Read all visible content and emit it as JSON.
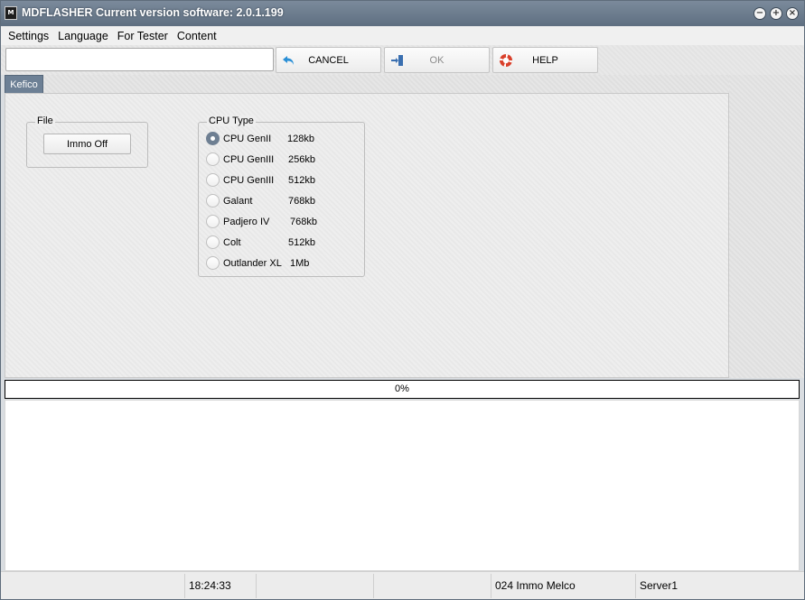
{
  "window": {
    "app_icon": "M",
    "title": "MDFLASHER  Current version software: 2.0.1.199",
    "controls": {
      "minimize": "−",
      "maximize": "+",
      "close": "×"
    }
  },
  "menu": {
    "items": [
      {
        "label": "Settings"
      },
      {
        "label": "Language"
      },
      {
        "label": "For Tester"
      },
      {
        "label": "Content"
      }
    ]
  },
  "toolbar": {
    "input_value": "",
    "cancel_label": "CANCEL",
    "ok_label": "OK",
    "help_label": "HELP",
    "colors": {
      "cancel_icon": "#2a8fd6",
      "ok_icon": "#3a6fb0",
      "help_icon": "#d9402b"
    }
  },
  "tabs": [
    {
      "label": "Kefico",
      "active": true
    }
  ],
  "file_group": {
    "title": "File",
    "immo_button": "Immo Off"
  },
  "cpu_group": {
    "title": "CPU Type",
    "options": [
      {
        "name": "CPU GenII",
        "size": "128kb",
        "checked": true
      },
      {
        "name": "CPU GenIII",
        "size": "256kb",
        "checked": false
      },
      {
        "name": "CPU GenIII",
        "size": "512kb",
        "checked": false
      },
      {
        "name": "Galant",
        "size": "768kb",
        "checked": false
      },
      {
        "name": "Padjero IV",
        "size": "768kb",
        "checked": false
      },
      {
        "name": "Colt",
        "size": "512kb",
        "checked": false
      },
      {
        "name": "Outlander XL",
        "size": "1Mb",
        "checked": false
      }
    ]
  },
  "progress": {
    "value": 0,
    "text": "0%"
  },
  "status": {
    "cell_1": "",
    "time": "18:24:33",
    "cell_3": "",
    "cell_4": "",
    "module": "024 Immo Melco",
    "server": "Server1"
  }
}
